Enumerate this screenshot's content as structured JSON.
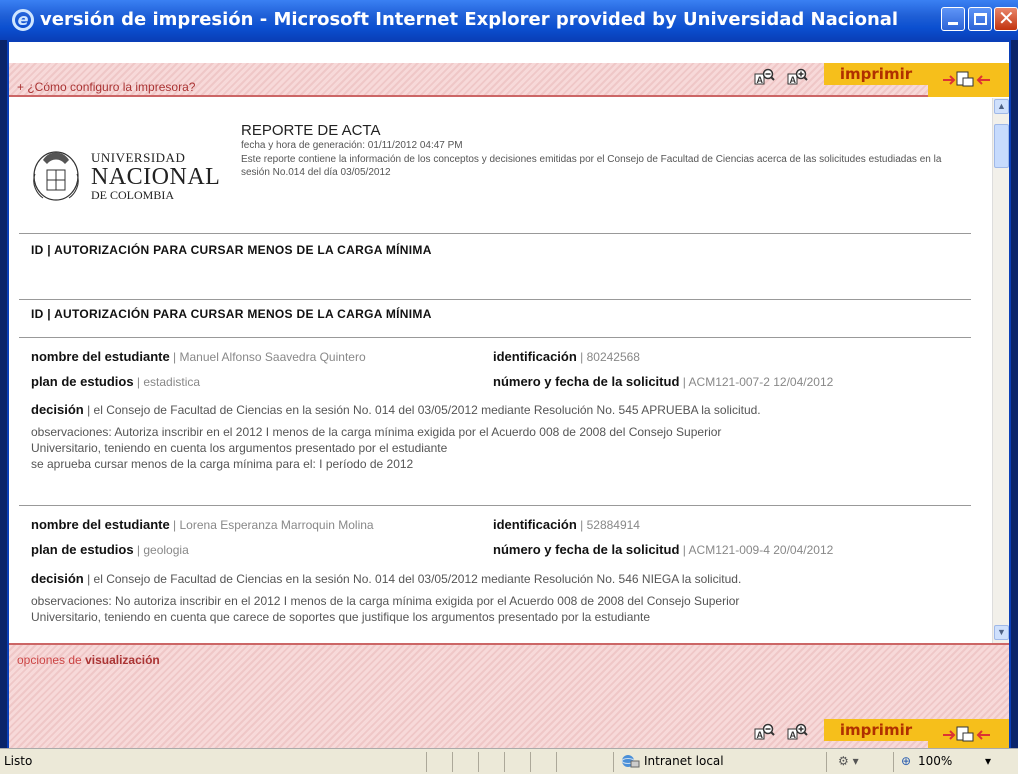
{
  "window": {
    "title": "versión de impresión - Microsoft Internet Explorer provided by Universidad Nacional"
  },
  "toolbar": {
    "help_link": "+ ¿Cómo configuro la impresora?",
    "print_label": "imprimir"
  },
  "report": {
    "logo": {
      "line1": "UNIVERSIDAD",
      "line2": "NACIONAL",
      "line3": "DE COLOMBIA"
    },
    "title": "REPORTE DE ACTA",
    "generated": "fecha y hora de generación: 01/11/2012 04:47 PM",
    "description": "Este reporte contiene la información de los conceptos y decisiones emitidas por el Consejo de Facultad de Ciencias acerca de las solicitudes estudiadas en la sesión No.014 del día 03/05/2012"
  },
  "sections": [
    "ID | AUTORIZACIÓN PARA CURSAR MENOS DE LA CARGA MÍNIMA",
    "ID | AUTORIZACIÓN PARA CURSAR MENOS DE LA CARGA MÍNIMA"
  ],
  "labels": {
    "student": "nombre del estudiante",
    "id": "identificación",
    "plan": "plan de estudios",
    "request": "número y fecha de la solicitud",
    "decision": "decisión"
  },
  "records": [
    {
      "name": "| Manuel Alfonso Saavedra Quintero",
      "id": "| 80242568",
      "plan": "| estadistica",
      "request": "| ACM121-007-2   12/04/2012",
      "decision": "| el Consejo de Facultad de Ciencias en la sesión No. 014 del 03/05/2012 mediante Resolución No. 545 APRUEBA la solicitud.",
      "obs1": "observaciones: Autoriza inscribir en el 2012 I menos de la carga mínima exigida por el Acuerdo 008 de 2008 del Consejo Superior",
      "obs2": "Universitario, teniendo en cuenta los argumentos presentado por el estudiante",
      "obs3": "se aprueba cursar menos de la carga mínima para el: I período de 2012"
    },
    {
      "name": "| Lorena Esperanza Marroquin Molina",
      "id": "| 52884914",
      "plan": "| geologia",
      "request": "| ACM121-009-4   20/04/2012",
      "decision": "| el Consejo de Facultad de Ciencias en la sesión No. 014 del 03/05/2012 mediante Resolución No. 546 NIEGA la solicitud.",
      "obs1": "observaciones: No autoriza inscribir en el 2012 I menos de la carga mínima exigida por el Acuerdo 008 de 2008 del Consejo Superior",
      "obs2": "Universitario, teniendo en cuenta que carece de soportes que justifique los argumentos presentado por la estudiante"
    }
  ],
  "bottom": {
    "options_label_1": "opciones de ",
    "options_label_2": "visualización"
  },
  "status": {
    "text": "Listo",
    "zone": "Intranet local",
    "zoom": "100%"
  },
  "colors": {
    "accent": "#f6bf1b",
    "hatch": "#f7d9d9",
    "link": "#aa3333",
    "titlebar": "#0b4fd0"
  }
}
